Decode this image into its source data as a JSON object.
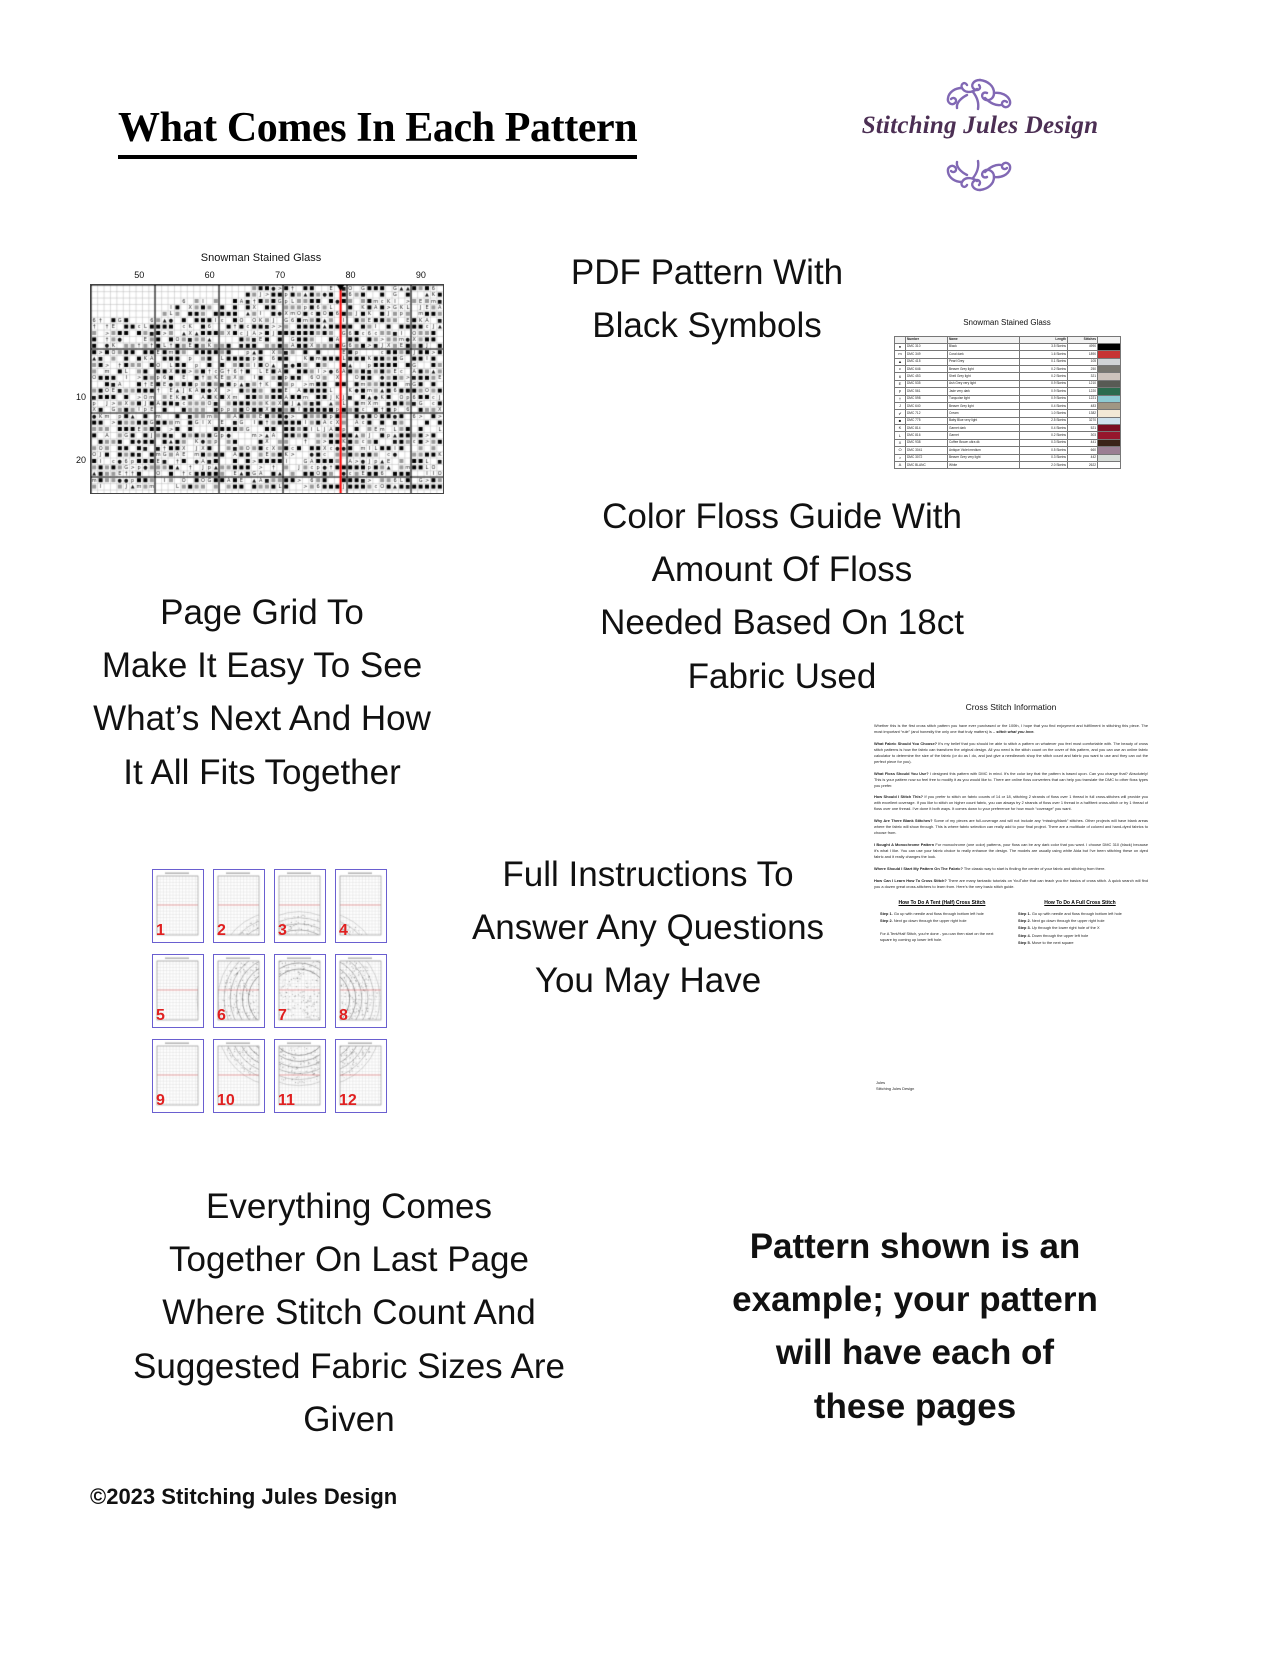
{
  "header": {
    "title": "What Comes In Each Pattern",
    "logo": {
      "brand_name": "Stitching Jules Design",
      "accent_color": "#8168b4",
      "text_color": "#4c2f54"
    }
  },
  "captions": {
    "pdf_pattern": "PDF Pattern With\nBlack Symbols",
    "page_grid": "Page Grid To\nMake It Easy To See\nWhat’s Next And How\nIt All Fits Together",
    "color_floss": "Color Floss Guide With\nAmount Of Floss\nNeeded Based On 18ct\nFabric Used",
    "full_instructions": "Full Instructions To\nAnswer Any Questions\nYou May Have",
    "everything_comes": "Everything Comes\nTogether On Last Page\nWhere Stitch Count And\nSuggested Fabric Sizes Are\nGiven",
    "disclaimer": "Pattern shown is an\nexample; your pattern\nwill have each of\nthese pages"
  },
  "chart_thumbnail": {
    "title": "Snowman Stained Glass",
    "column_labels": [
      "50",
      "60",
      "70",
      "80",
      "90"
    ],
    "row_labels": [
      "10",
      "20"
    ],
    "center_marker_color": "#ff0000"
  },
  "floss_guide": {
    "title": "Snowman Stained Glass",
    "columns": [
      "",
      "Number",
      "Name",
      "Length",
      "Stitches",
      ""
    ],
    "rows": [
      {
        "symbol": "●",
        "number": "DMC    310",
        "name": "Black",
        "length": "3.5 Skeins",
        "stitches": "4990",
        "swatch": "#000000"
      },
      {
        "symbol": "m",
        "number": "DMC    349",
        "name": "Coral dark",
        "length": "1.6 Skeins",
        "stitches": "1890",
        "swatch": "#c63333"
      },
      {
        "symbol": "▲",
        "number": "DMC    415",
        "name": "Pearl Grey",
        "length": "0.1 Skeins",
        "stitches": "105",
        "swatch": "#d0d3d6"
      },
      {
        "symbol": "c",
        "number": "DMC    646",
        "name": "Beaver Grey light",
        "length": "0.2 Skeins",
        "stitches": "250",
        "swatch": "#777670"
      },
      {
        "symbol": "6",
        "number": "DMC    453",
        "name": "Shell Grey light",
        "length": "0.2 Skeins",
        "stitches": "321",
        "swatch": "#cdc3bd"
      },
      {
        "symbol": "E",
        "number": "DMC    535",
        "name": "Ash Grey very light",
        "length": "0.9 Skeins",
        "stitches": "1210",
        "swatch": "#585a54"
      },
      {
        "symbol": "p",
        "number": "DMC    561",
        "name": "Jade very dark",
        "length": "0.9 Skeins",
        "stitches": "1220",
        "swatch": "#2b6b4e"
      },
      {
        "symbol": "†",
        "number": "DMC    598",
        "name": "Turquoise light",
        "length": "0.9 Skeins",
        "stitches": "1221",
        "swatch": "#8ecbd4"
      },
      {
        "symbol": "J",
        "number": "DMC    640",
        "name": "Beaver Grey light",
        "length": "0.4 Skeins",
        "stitches": "483",
        "swatch": "#a09684"
      },
      {
        "symbol": "✔",
        "number": "DMC    712",
        "name": "Cream",
        "length": "1.0 Skeins",
        "stitches": "1382",
        "swatch": "#f3e9d6"
      },
      {
        "symbol": "■",
        "number": "DMC    775",
        "name": "Baby Blue very light",
        "length": "2.5 Skeins",
        "stitches": "3270",
        "swatch": "#cfe3ee"
      },
      {
        "symbol": "K",
        "number": "DMC    814",
        "name": "Garnet dark",
        "length": "0.4 Skeins",
        "stitches": "521",
        "swatch": "#7a0f22"
      },
      {
        "symbol": "L",
        "number": "DMC    816",
        "name": "Garnet",
        "length": "0.2 Skeins",
        "stitches": "303",
        "swatch": "#96172c"
      },
      {
        "symbol": "X",
        "number": "DMC    938",
        "name": "Coffee Brown ultra dk",
        "length": "0.3 Skeins",
        "stitches": "441",
        "swatch": "#3a2317"
      },
      {
        "symbol": "O",
        "number": "DMC    3041",
        "name": "Antique Violet medium",
        "length": "0.5 Skeins",
        "stitches": "660",
        "swatch": "#9b7f93"
      },
      {
        "symbol": ">",
        "number": "DMC    3072",
        "name": "Beaver Grey very light",
        "length": "0.3 Skeins",
        "stitches": "442",
        "swatch": "#d7dcd8"
      },
      {
        "symbol": "A",
        "number": "DMC    BLANC",
        "name": "White",
        "length": "2.0 Skeins",
        "stitches": "2622",
        "swatch": "#ffffff"
      }
    ]
  },
  "page_grid": {
    "thumbnail_numbers": [
      "1",
      "2",
      "3",
      "4",
      "5",
      "6",
      "7",
      "8",
      "9",
      "10",
      "11",
      "12"
    ],
    "border_color": "#6a5fd0",
    "number_color": "#e02020"
  },
  "instructions": {
    "title": "Cross Stitch Information",
    "intro": "Whether this is the first cross stitch pattern you have ever purchased or the 100th, I hope that you find enjoyment and fulfillment in stitching this piece. The most important “rule” (and honestly the only one that truly matters) is – ",
    "intro_emphasis": "stitch what you love.",
    "sections": [
      {
        "heading": "What Fabric Should You Choose?",
        "body": " It’s my belief that you should be able to stitch a pattern on whatever you feel most comfortable with. The beauty of cross stitch patterns is how the fabric can transform the original design.  All you need is the stitch count on the cover of this pattern, and you can use an online fabric calculator to determine the size of the fabric (or do as I do, and just give a needlework shop the stitch count and fabric you want to use and they can cut the perfect piece for you)."
      },
      {
        "heading": "What Floss Should You Use?",
        "body": " I designed this pattern with DMC in mind. It’s the color key that the pattern is based upon. Can you change that? Absolutely! This is your pattern now so feel free to modify it as you would like to.  There are online floss converters that can help you translate the DMC to other floss types you prefer."
      },
      {
        "heading": "How Should I Stitch This?",
        "body": " If you prefer to stitch on fabric counts of 14 or 18, stitching 2 strands of floss over 1 thread in full cross-stitches will provide you with excellent coverage. If you like to stitch on higher count fabric, you can always try 2 strands of floss over 1 thread in a half/tent cross-stitch or try 1 thread of floss over one thread. I’ve done it both ways. It comes down to your preference for how much “coverage” you want."
      },
      {
        "heading": "Why Are There Blank Stitches?",
        "body": " Some of my pieces are full-coverage and will not include any “missing/blank” stitches. Other projects will have blank areas where the fabric will show through. This is where fabric selection can really add to your final project. There are a multitude of colored and hand-dyed fabrics to choose from."
      },
      {
        "heading": "I Bought A Monochrome Pattern",
        "body": " For monochrome (one color) patterns, your floss can be any dark color that you want. I choose DMC 310 (black) because it’s what I like. You can use your fabric choice to really enhance the design. The models are usually using white Aida but I’ve been stitching these on dyed fabric and it really changes the look."
      },
      {
        "heading": "Where Should I Start My Pattern On The Fabric?",
        "body": " The classic way to start is finding the center of your fabric and stitching from there."
      },
      {
        "heading": "How Can I Learn How To Cross Stitch?",
        "body": " There are many fantastic tutorials on YouTube that can teach you the basics of cross stitch. A quick search will find you a dozen great cross-stitchers to learn from. Here’s the very basic stitch guide."
      }
    ],
    "how_to_columns": [
      {
        "heading": "How To Do A Tent (Half) Cross Stitch",
        "steps": [
          {
            "label": "Step 1.",
            "text": " Go up with needle and floss through bottom left hole"
          },
          {
            "label": "Step 2.",
            "text": " Next go down through the upper right hole"
          }
        ],
        "note": "For A Tent/Half Stitch, you’re done - you can then start on the next square by coming up lower left hole."
      },
      {
        "heading": "How To Do A Full Cross Stitch",
        "steps": [
          {
            "label": "Step 1.",
            "text": " Go up with needle and floss through bottom left hole"
          },
          {
            "label": "Step 2.",
            "text": " Next go down through the upper right hole"
          },
          {
            "label": "Step 3.",
            "text": " Up through the lower right hole of the X"
          },
          {
            "label": "Step 4.",
            "text": " Down through the upper left hole"
          },
          {
            "label": "Step 5.",
            "text": " Move to the next square"
          }
        ],
        "note": ""
      }
    ],
    "signature_line1": "Jules",
    "signature_line2": "Stitching Jules Design"
  },
  "footer": {
    "copyright": "©2023 Stitching Jules Design"
  }
}
